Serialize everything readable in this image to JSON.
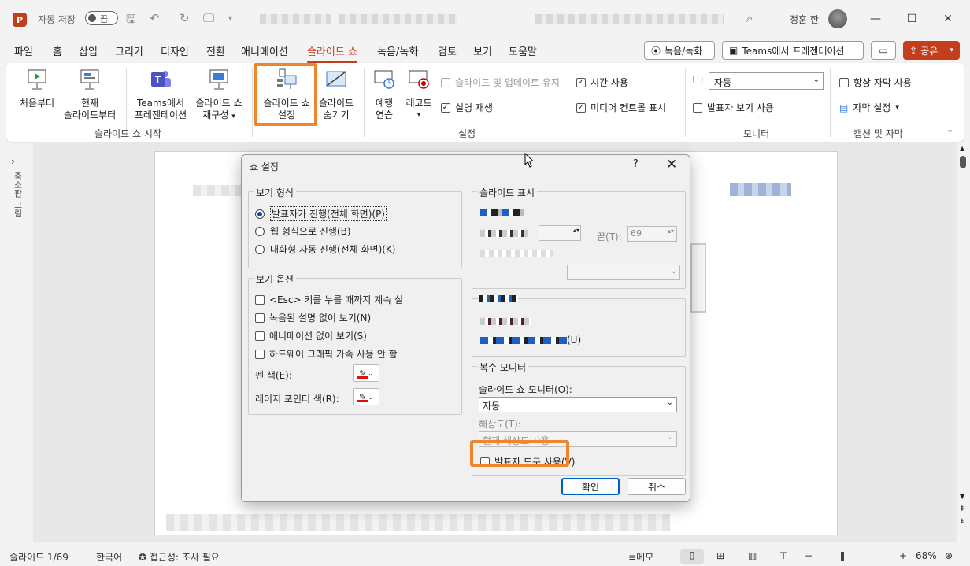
{
  "titlebar": {
    "app_letter": "P",
    "autosave_label": "자동 저장",
    "autosave_state": "끔",
    "user_name": "정훈 한"
  },
  "menu": {
    "tabs": [
      "파일",
      "홈",
      "삽입",
      "그리기",
      "디자인",
      "전환",
      "애니메이션",
      "슬라이드 쇼",
      "녹음/녹화",
      "검토",
      "보기",
      "도움말"
    ],
    "active_tab": "슬라이드 쇼",
    "record_button": "녹음/녹화",
    "teams_button": "Teams에서 프레젠테이션",
    "share_button": "공유"
  },
  "ribbon": {
    "from_beginning": "처음부터",
    "from_current_1": "현재",
    "from_current_2": "슬라이드부터",
    "teams_present_1": "Teams에서",
    "teams_present_2": "프레젠테이션",
    "custom_show_1": "슬라이드 쇼",
    "custom_show_2": "재구성",
    "setup_show_1": "슬라이드 쇼",
    "setup_show_2": "설정",
    "hide_slide_1": "슬라이드",
    "hide_slide_2": "숨기기",
    "rehearse_1": "예행",
    "rehearse_2": "연습",
    "record": "레코드",
    "keep_updated": "슬라이드 및 업데이트 유지",
    "play_narrations": "설명 재생",
    "use_timings": "시간 사용",
    "show_media_controls": "미디어 컨트롤 표시",
    "monitor_select": "자동",
    "presenter_view": "발표자 보기 사용",
    "always_subtitles": "항상 자막 사용",
    "subtitle_settings": "자막 설정",
    "group_start": "슬라이드 쇼 시작",
    "group_setup": "설정",
    "group_monitor": "모니터",
    "group_captions": "캡션 및 자막"
  },
  "leftpane": {
    "label": "축소판 그림"
  },
  "dialog": {
    "title": "쇼 설정",
    "help": "?",
    "show_type_legend": "보기 형식",
    "show_type_options": [
      "발표자가 진행(전체 화면)(P)",
      "웹 형식으로 진행(B)",
      "대화형 자동 진행(전체 화면)(K)"
    ],
    "show_options_legend": "보기 옵션",
    "opt_loop": "<Esc> 키를 누를 때까지 계속 실",
    "opt_no_narration": "녹음된 설명 없이 보기(N)",
    "opt_no_animation": "애니메이션 없이 보기(S)",
    "opt_no_hw": "하드웨어 그래픽 가속 사용 안 함",
    "pen_color_label": "펜 색(E):",
    "laser_color_label": "레이저 포인터 색(R):",
    "pen_color": "#e01010",
    "slides_legend": "슬라이드 표시",
    "to_label": "끝(T):",
    "to_value": "69",
    "use_timings_suffix": "(U)",
    "multi_monitor_legend": "복수 모니터",
    "show_monitor_label": "슬라이드 쇼 모니터(O):",
    "show_monitor_value": "자동",
    "resolution_label": "해상도(T):",
    "resolution_value": "현재 해상도 사용",
    "presenter_tools": "발표자 도구 사용(V)",
    "ok": "확인",
    "cancel": "취소"
  },
  "status": {
    "slide_info": "슬라이드 1/69",
    "language": "한국어",
    "accessibility": "접근성: 조사 필요",
    "notes": "메모",
    "zoom": "68%"
  },
  "colors": {
    "accent": "#c43e1c",
    "highlight": "#f0862b"
  }
}
